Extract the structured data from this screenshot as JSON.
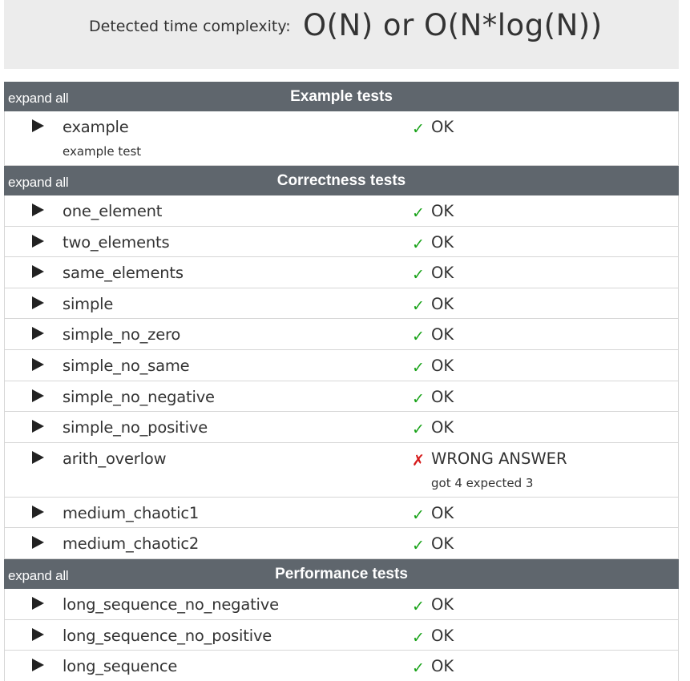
{
  "summary": {
    "label": "Detected time complexity:",
    "value": "O(N) or O(N*log(N))"
  },
  "colors": {
    "header_bg": "#5f666d",
    "ok": "#1aa31a",
    "fail": "#d61b1b",
    "summary_bg": "#ececec"
  },
  "sections": [
    {
      "expand_label": "expand all",
      "title": "Example tests",
      "tests": [
        {
          "name": "example",
          "description": "example test",
          "icon": "check-icon",
          "symbol": "✓",
          "status": "OK",
          "detail": ""
        }
      ]
    },
    {
      "expand_label": "expand all",
      "title": "Correctness tests",
      "tests": [
        {
          "name": "one_element",
          "description": "",
          "icon": "check-icon",
          "symbol": "✓",
          "status": "OK",
          "detail": ""
        },
        {
          "name": "two_elements",
          "description": "",
          "icon": "check-icon",
          "symbol": "✓",
          "status": "OK",
          "detail": ""
        },
        {
          "name": "same_elements",
          "description": "",
          "icon": "check-icon",
          "symbol": "✓",
          "status": "OK",
          "detail": ""
        },
        {
          "name": "simple",
          "description": "",
          "icon": "check-icon",
          "symbol": "✓",
          "status": "OK",
          "detail": ""
        },
        {
          "name": "simple_no_zero",
          "description": "",
          "icon": "check-icon",
          "symbol": "✓",
          "status": "OK",
          "detail": ""
        },
        {
          "name": "simple_no_same",
          "description": "",
          "icon": "check-icon",
          "symbol": "✓",
          "status": "OK",
          "detail": ""
        },
        {
          "name": "simple_no_negative",
          "description": "",
          "icon": "check-icon",
          "symbol": "✓",
          "status": "OK",
          "detail": ""
        },
        {
          "name": "simple_no_positive",
          "description": "",
          "icon": "check-icon",
          "symbol": "✓",
          "status": "OK",
          "detail": ""
        },
        {
          "name": "arith_overlow",
          "description": "",
          "icon": "cross-icon",
          "symbol": "✗",
          "status": "WRONG ANSWER",
          "detail": "got 4 expected 3"
        },
        {
          "name": "medium_chaotic1",
          "description": "",
          "icon": "check-icon",
          "symbol": "✓",
          "status": "OK",
          "detail": ""
        },
        {
          "name": "medium_chaotic2",
          "description": "",
          "icon": "check-icon",
          "symbol": "✓",
          "status": "OK",
          "detail": ""
        }
      ]
    },
    {
      "expand_label": "expand all",
      "title": "Performance tests",
      "tests": [
        {
          "name": "long_sequence_no_negative",
          "description": "",
          "icon": "check-icon",
          "symbol": "✓",
          "status": "OK",
          "detail": ""
        },
        {
          "name": "long_sequence_no_positive",
          "description": "",
          "icon": "check-icon",
          "symbol": "✓",
          "status": "OK",
          "detail": ""
        },
        {
          "name": "long_sequence",
          "description": "",
          "icon": "check-icon",
          "symbol": "✓",
          "status": "OK",
          "detail": ""
        }
      ]
    }
  ]
}
